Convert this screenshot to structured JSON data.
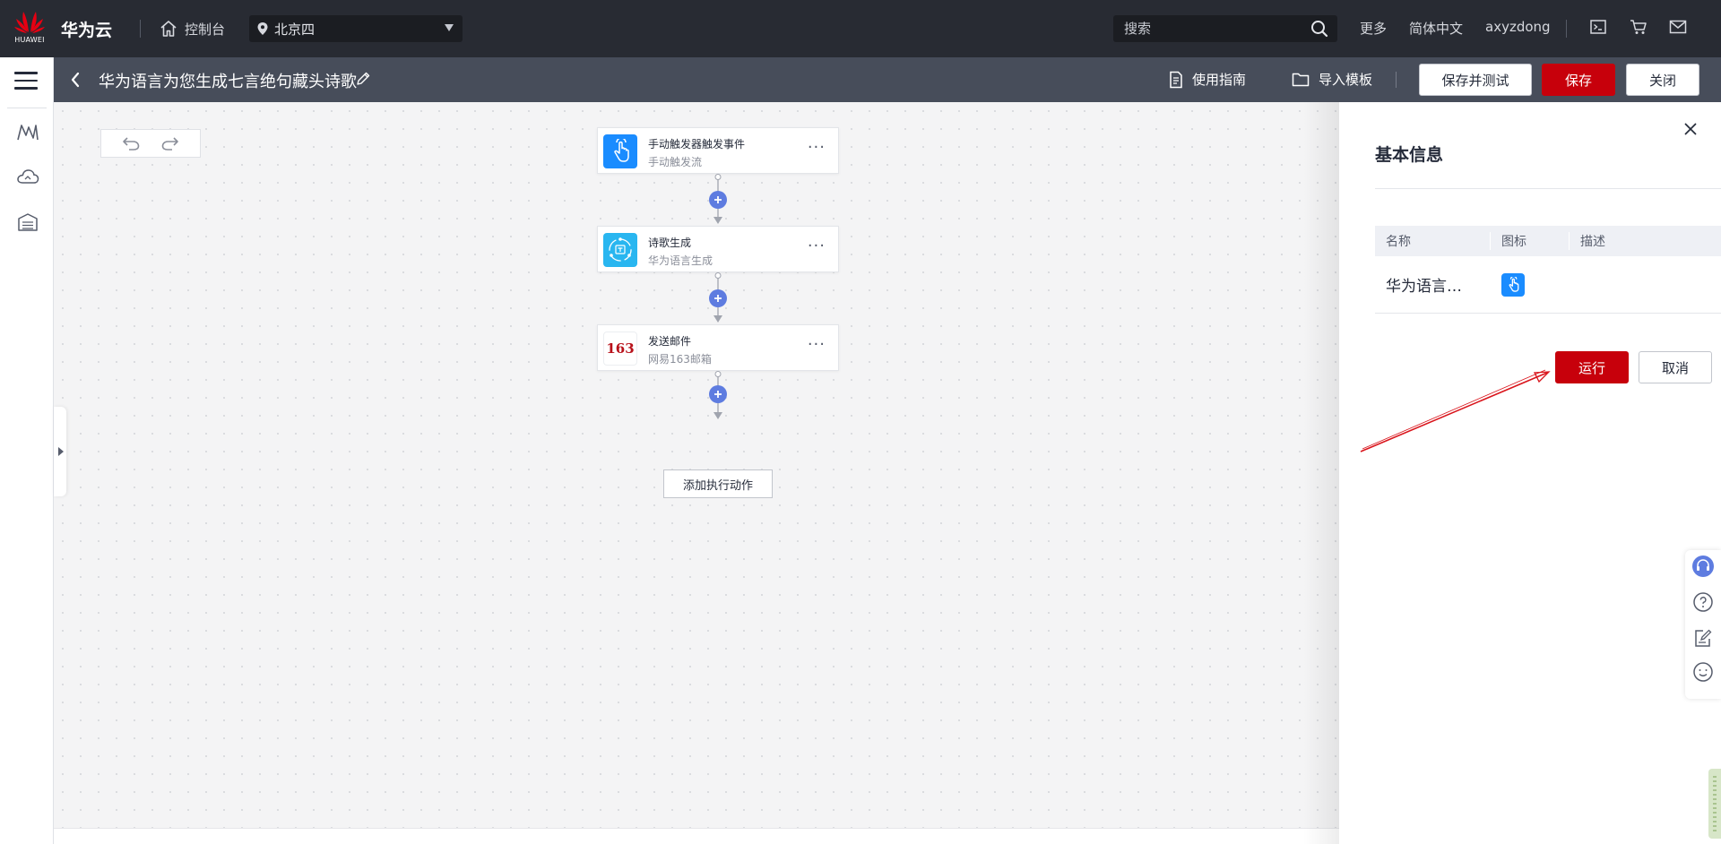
{
  "header": {
    "logo_text": "HUAWEI",
    "brand": "华为云",
    "console": "控制台",
    "region": "北京四",
    "search_placeholder": "搜索",
    "more": "更多",
    "language": "简体中文",
    "username": "axyzdong"
  },
  "subheader": {
    "title": "华为语言为您生成七言绝句藏头诗歌",
    "guide": "使用指南",
    "import_template": "导入模板",
    "save_test": "保存并测试",
    "save": "保存",
    "close": "关闭"
  },
  "canvas": {
    "nodes": [
      {
        "title": "手动触发器触发事件",
        "subtitle": "手动触发流",
        "icon": "hand-tap-icon",
        "color": "#1a8cff"
      },
      {
        "title": "诗歌生成",
        "subtitle": "华为语言生成",
        "icon": "ai-generate-icon",
        "color": "#29b6f0"
      },
      {
        "title": "发送邮件",
        "subtitle": "网易163邮箱",
        "icon": "mail-163-icon",
        "icon_text": "163",
        "color": "#b8111a"
      }
    ],
    "add_action": "添加执行动作",
    "more_glyph": "···"
  },
  "panel": {
    "title": "基本信息",
    "table": {
      "headers": [
        "名称",
        "图标",
        "描述"
      ],
      "row": {
        "name": "华为语言…",
        "icon": "hand-tap-icon",
        "description": ""
      }
    },
    "run": "运行",
    "cancel": "取消"
  },
  "colors": {
    "accent_red": "#c7000b",
    "header_bg": "#282b33",
    "subheader_bg": "#474d5a",
    "connector_blue": "#5e7ce0"
  }
}
